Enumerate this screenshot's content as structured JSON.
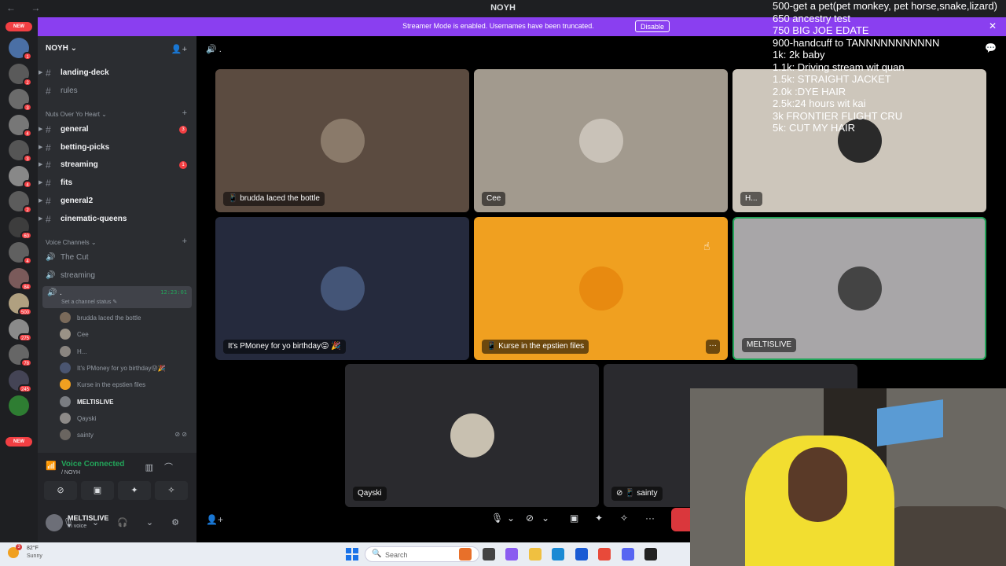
{
  "titlebar": {
    "nav": "← →",
    "title": "NOYH"
  },
  "banner": {
    "text": "Streamer Mode is enabled. Usernames have been truncated.",
    "disable_label": "Disable",
    "close_glyph": "✕"
  },
  "rail": {
    "new_top": "NEW",
    "new_bottom": "NEW",
    "servers": [
      {
        "badge": "1"
      },
      {
        "badge": "2"
      },
      {
        "badge": "3"
      },
      {
        "badge": "4"
      },
      {
        "badge": "3"
      },
      {
        "badge": "4"
      },
      {
        "badge": "2"
      },
      {
        "badge": "60"
      },
      {
        "badge": "4"
      },
      {
        "badge": "84"
      },
      {
        "badge": "500"
      },
      {
        "badge": "275"
      },
      {
        "badge": "78"
      },
      {
        "badge": "245"
      },
      {
        "badge": ""
      }
    ]
  },
  "sidebar": {
    "server_name": "NOYH ⌄",
    "channels_top": [
      {
        "name": "landing-deck",
        "unread": true
      },
      {
        "name": "rules",
        "unread": false
      }
    ],
    "category1": "Nuts Over Yo Heart ⌄",
    "channels": [
      {
        "name": "general",
        "unread": true,
        "badge": "3"
      },
      {
        "name": "betting-picks",
        "unread": true,
        "badge": ""
      },
      {
        "name": "streaming",
        "unread": true,
        "badge": "1"
      },
      {
        "name": "fits",
        "unread": true,
        "badge": ""
      },
      {
        "name": "general2",
        "unread": true,
        "badge": ""
      },
      {
        "name": "cinematic-queens",
        "unread": true,
        "badge": ""
      }
    ],
    "category2": "Voice Channels ⌄",
    "voice_channels": [
      "The Cut",
      "streaming"
    ],
    "active_voice": {
      "name": ".",
      "timer": "12:23:01",
      "status": "Set a channel status ✎"
    },
    "voice_users": [
      {
        "name": "brudda laced the bottle",
        "me": false,
        "color": "#7a6a5a"
      },
      {
        "name": "Cee",
        "me": false,
        "color": "#9a9286"
      },
      {
        "name": "H...",
        "me": false,
        "color": "#8a8580"
      },
      {
        "name": "It's PMoney for yo birthday😜🎉",
        "me": false,
        "color": "#4a5570"
      },
      {
        "name": "Kurse in the epstien files",
        "me": false,
        "color": "#f0a020"
      },
      {
        "name": "MELTISLIVE",
        "me": true,
        "color": "#7a7d82"
      },
      {
        "name": "Qayski",
        "me": false,
        "color": "#8d8a88"
      },
      {
        "name": "sainty",
        "me": false,
        "color": "#6a6560",
        "icons": "⊘ ⊘"
      }
    ]
  },
  "voice_panel": {
    "title": "Voice Connected",
    "subtitle": "/ NOYH",
    "buttons": [
      "⊘",
      "▣",
      "✦",
      "✧"
    ]
  },
  "userbar": {
    "name": "MELTISLIVE",
    "status": "In voice",
    "controls": "🎙 ⌄ 🎧 ⌄ ⚙"
  },
  "stage": {
    "header": "🔊 .",
    "tiles": [
      {
        "label": "📱 brudda laced the bottle",
        "bg": "#5b4b40",
        "avatar": "#8a7a6a"
      },
      {
        "label": "Cee",
        "bg": "#a29a8e",
        "avatar": "#c9c2b8"
      },
      {
        "label": "H...",
        "bg": "#cdc6bb",
        "avatar": "#2a2a2a"
      },
      {
        "label": "It's PMoney for yo birthday😜 🎉",
        "bg": "#252a3d",
        "avatar": "#445577"
      },
      {
        "label": "📱 Kurse in the epstien files",
        "bg": "#f0a020",
        "avatar": "#e88a10"
      },
      {
        "label": "MELTISLIVE",
        "bg": "#a8a6a8",
        "avatar": "#444444"
      },
      {
        "label": "Qayski",
        "bg": "#2a2a2e",
        "avatar": "#c8c0b0"
      },
      {
        "label": "⊘ 📱 sainty",
        "bg": "#2a2a2e",
        "avatar": "#2a2a2e"
      }
    ],
    "more_glyph": "···",
    "call_controls": [
      "🎙",
      "⌄",
      "⊘",
      "⌄",
      "▣",
      "✦",
      "✧",
      "···"
    ]
  },
  "goals": [
    "500-get a pet(pet monkey, pet horse,snake,lizard)",
    "650 ancestry test",
    "750 BIG JOE EDATE",
    "900-handcuff to TANNNNNNNNNNN",
    "1k: 2k baby",
    "1.1k: Driving stream wit quan",
    "1.5k: STRAIGHT JACKET",
    "2.0k :DYE HAIR",
    "2.5k:24 hours wit kai",
    "3k FRONTIER FLIGHT CRU",
    "5k: CUT MY HAIR"
  ],
  "taskbar": {
    "weather_badge": "3",
    "temp": "82°F",
    "condition": "Sunny",
    "search_placeholder": "Search",
    "apps": [
      {
        "name": "game-app",
        "color": "#e8702a"
      },
      {
        "name": "terminal-app",
        "color": "#444"
      },
      {
        "name": "copilot-app",
        "color": "#8a5cf0"
      },
      {
        "name": "file-explorer-app",
        "color": "#f0c040"
      },
      {
        "name": "edge-app",
        "color": "#1a8ad4"
      },
      {
        "name": "store-app",
        "color": "#1a5bd4"
      },
      {
        "name": "chrome-app",
        "color": "#e84a3a"
      },
      {
        "name": "discord-app",
        "color": "#5865f2"
      },
      {
        "name": "other-app",
        "color": "#222"
      }
    ]
  }
}
